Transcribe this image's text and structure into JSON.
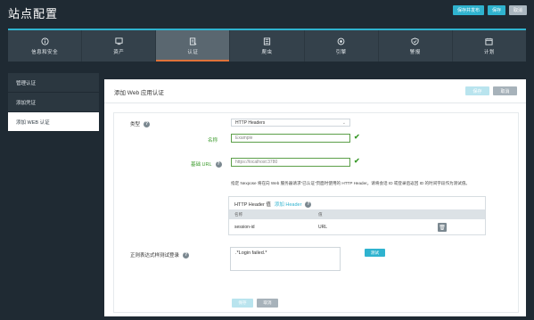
{
  "page": {
    "title": "站点配置"
  },
  "top_actions": [
    {
      "label": "保存并发布",
      "style": "primary"
    },
    {
      "label": "保存",
      "style": "primary"
    },
    {
      "label": "取消",
      "style": "grey"
    }
  ],
  "tabs": [
    {
      "label": "信息和安全",
      "icon": "info-icon"
    },
    {
      "label": "资产",
      "icon": "asset-icon"
    },
    {
      "label": "认证",
      "icon": "auth-icon",
      "active": true
    },
    {
      "label": "爬虫",
      "icon": "crawler-icon"
    },
    {
      "label": "引擎",
      "icon": "engine-icon"
    },
    {
      "label": "警报",
      "icon": "alert-icon"
    },
    {
      "label": "计划",
      "icon": "calendar-icon"
    }
  ],
  "progress_fraction": 1.0,
  "sidebar": {
    "items": [
      {
        "label": "管理认证",
        "active": false
      },
      {
        "label": "添加凭证",
        "active": false
      },
      {
        "label": "添加 WEB 认证",
        "active": true
      }
    ]
  },
  "panel": {
    "title": "添加 Web 应用认证",
    "save_label": "保存",
    "cancel_label": "取消"
  },
  "form": {
    "type_label": "类型",
    "type_value": "HTTP Headers",
    "name_label": "名称",
    "name_value": "Example",
    "base_url_label": "基础 URL",
    "base_url_value": "https://localhost:3780",
    "info_text": "指定 Nexpose 将在向 Web 服务器请求\"已认证\"页面时使用的 HTTP Header。请将会话 ID 或登录后返回 ID 的时间字段作为测试值。",
    "header_table": {
      "title": "HTTP Header 值",
      "add_label": "添加 Header",
      "columns": [
        "名称",
        "值"
      ],
      "rows": [
        {
          "name": "session-id",
          "value": "URL"
        }
      ]
    },
    "regex_label": "正则表达式样测试登录",
    "regex_value": ".*Login failed.*",
    "test_label": "测试",
    "save_label": "保存",
    "cancel_label": "取消"
  },
  "colors": {
    "accent": "#2fb3cf",
    "orange": "#e0733a",
    "success": "#3a9a2a",
    "dark_bg": "#1f2a33"
  }
}
